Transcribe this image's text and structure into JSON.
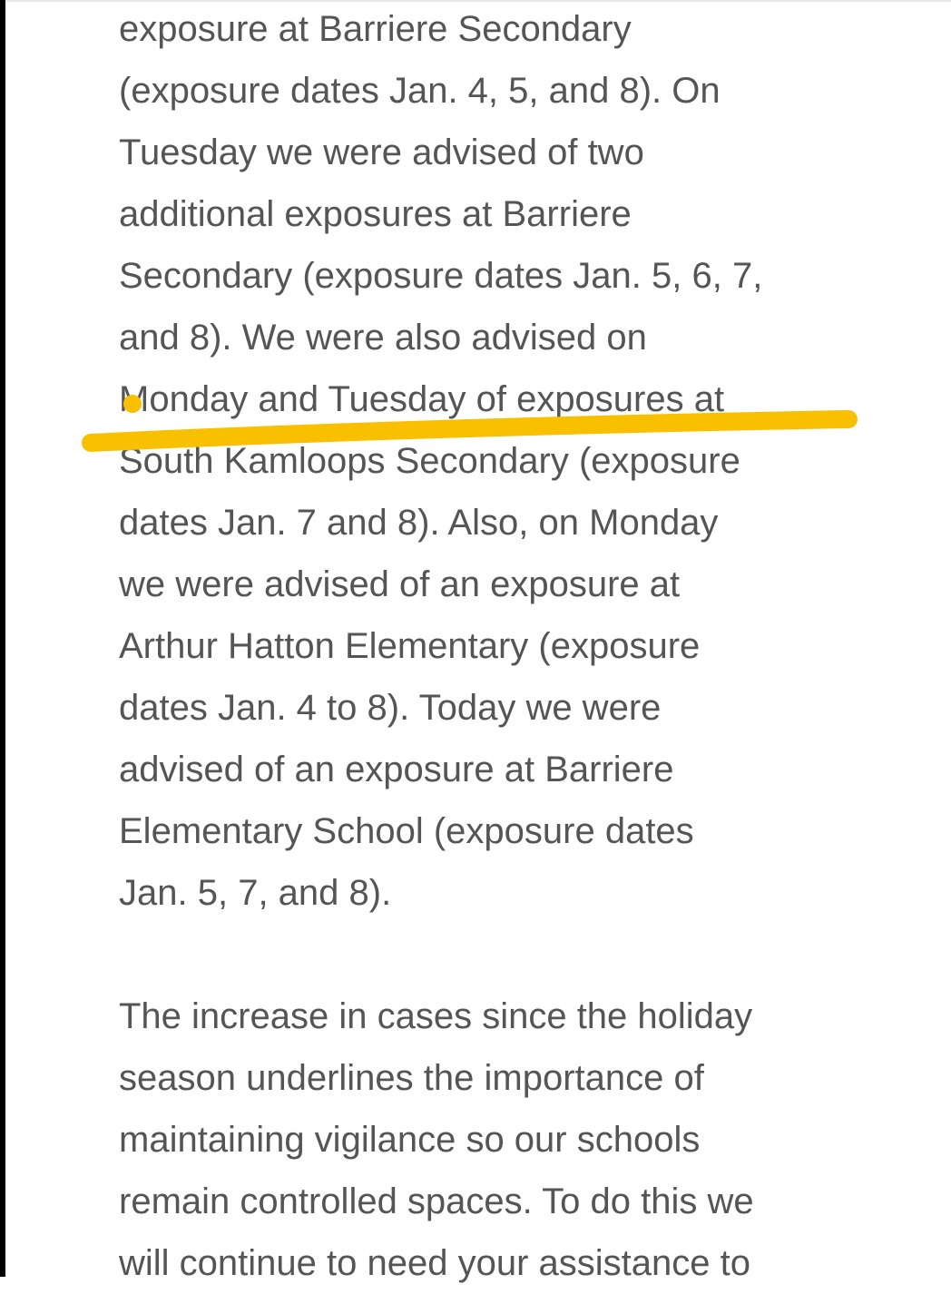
{
  "article": {
    "paragraphs": [
      {
        "lines": [
          "exposure at Barriere Secondary",
          "(exposure dates Jan. 4, 5, and 8). On",
          "Tuesday we were advised of two",
          "additional exposures at Barriere",
          "Secondary (exposure dates Jan. 5, 6, 7,",
          "and 8). We were also advised on",
          "Monday and Tuesday of exposures at",
          "South Kamloops Secondary (exposure",
          "dates Jan. 7 and 8). Also, on Monday",
          "we were advised of an exposure at",
          "Arthur Hatton Elementary (exposure",
          "dates Jan. 4 to 8). Today we were",
          "advised of an exposure at Barriere",
          "Elementary School (exposure dates",
          "Jan. 5, 7, and 8)."
        ]
      },
      {
        "lines": [
          "The increase in cases since the holiday",
          "season underlines the importance of",
          "maintaining vigilance so our schools",
          "remain controlled spaces. To do this we",
          "will continue to need your assistance to"
        ]
      }
    ]
  },
  "annotation": {
    "color": "#F8C000"
  }
}
